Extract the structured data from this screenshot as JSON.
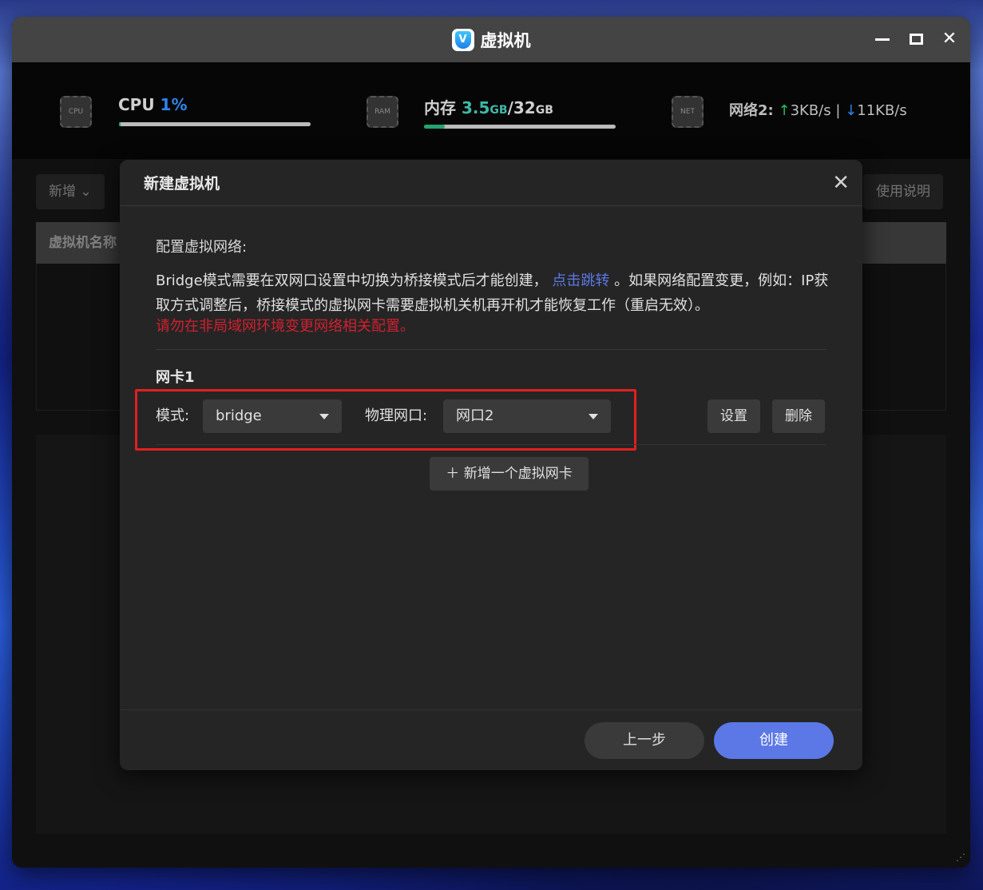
{
  "window": {
    "title": "虚拟机",
    "app_icon_letter": "V",
    "minimize": "minimize-icon",
    "maximize": "maximize-icon",
    "close": "✕"
  },
  "stats": {
    "cpu": {
      "icon_text": "CPU",
      "label": "CPU",
      "value": "1%",
      "progress": 0.01
    },
    "ram": {
      "icon_text": "RAM",
      "label": "内存",
      "used": "3.5",
      "used_unit": "GB",
      "sep": "/",
      "total": "32",
      "total_unit": "GB",
      "progress": 0.11
    },
    "net": {
      "icon_text": "NET",
      "label": "网络2:",
      "up_arrow": "↑",
      "up": "3KB/s",
      "bar": "|",
      "down_arrow": "↓",
      "down": "11KB/s"
    }
  },
  "toolbar": {
    "add_label": "新增",
    "help_label": "使用说明"
  },
  "table": {
    "first_column": "虚拟机名称"
  },
  "dialog": {
    "title": "新建虚拟机",
    "close": "✕",
    "section_title": "配置虚拟网络:",
    "desc_part1": "Bridge模式需要在双网口设置中切换为桥接模式后才能创建，",
    "desc_link": "点击跳转",
    "desc_part2": "。如果网络配置变更，例如：IP获取方式调整后，桥接模式的虚拟网卡需要虚拟机关机再开机才能恢复工作（重启无效）。",
    "warning": "请勿在非局域网环境变更网络相关配置。",
    "nic_title": "网卡1",
    "mode_label": "模式:",
    "mode_value": "bridge",
    "port_label": "物理网口:",
    "port_value": "网口2",
    "settings_btn": "设置",
    "delete_btn": "删除",
    "add_nic_btn": "＋ 新增一个虚拟网卡",
    "prev_btn": "上一步",
    "create_btn": "创建"
  },
  "colors": {
    "accent": "#5b78e6",
    "warning": "#d0202f",
    "highlight_box": "#e02020",
    "progress": "#23a36f"
  }
}
